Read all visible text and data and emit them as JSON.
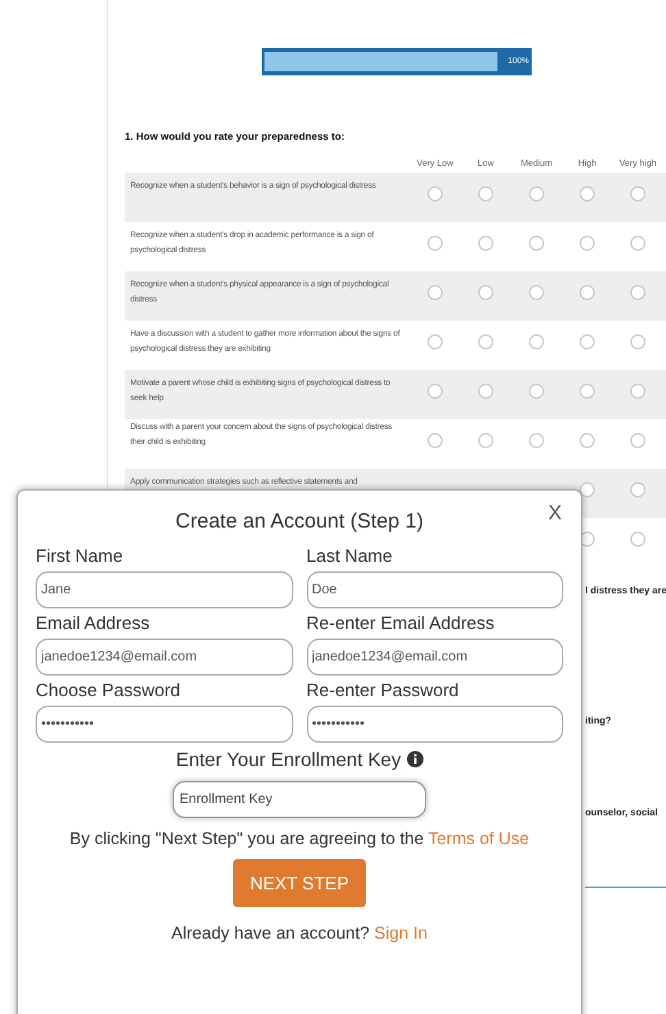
{
  "progress": {
    "label": "100%"
  },
  "question": {
    "title": "1. How would you rate your preparedness to:",
    "columns": [
      "Very Low",
      "Low",
      "Medium",
      "High",
      "Very high"
    ],
    "rows": [
      {
        "label": "Recognize when a student's behavior is a sign of psychological distress",
        "choices": [
          {
            "selected": false
          },
          {
            "selected": false
          },
          {
            "selected": false
          },
          {
            "selected": false
          },
          {
            "selected": false
          }
        ]
      },
      {
        "label": "Recognize when a student's drop in academic performance is a sign of psychological distress",
        "choices": [
          {
            "selected": false
          },
          {
            "selected": false
          },
          {
            "selected": false
          },
          {
            "selected": false
          },
          {
            "selected": false
          }
        ]
      },
      {
        "label": "Recognize when a student's physical appearance is a sign of psychological distress",
        "choices": [
          {
            "selected": false
          },
          {
            "selected": false
          },
          {
            "selected": false
          },
          {
            "selected": false
          },
          {
            "selected": false
          }
        ]
      },
      {
        "label": "Have a discussion with a student to gather more information about the signs of psychological distress they are exhibiting",
        "choices": [
          {
            "selected": false
          },
          {
            "selected": false
          },
          {
            "selected": false
          },
          {
            "selected": false
          },
          {
            "selected": false
          }
        ]
      },
      {
        "label": "Motivate a parent whose child is exhibiting signs of psychological distress to seek help",
        "choices": [
          {
            "selected": false
          },
          {
            "selected": false
          },
          {
            "selected": false
          },
          {
            "selected": false
          },
          {
            "selected": false
          }
        ]
      },
      {
        "label": "Discuss with a parent your concern about the signs of psychological distress their child is exhibiting",
        "choices": [
          {
            "selected": false
          },
          {
            "selected": false
          },
          {
            "selected": false
          },
          {
            "selected": false
          },
          {
            "selected": false
          }
        ]
      },
      {
        "label": "Apply communication strategies such as reflective statements and",
        "choices": [
          {
            "selected": false
          },
          {
            "selected": false
          }
        ]
      },
      {
        "choices": [
          {
            "selected": false
          },
          {
            "selected": false
          }
        ]
      }
    ]
  },
  "cut_questions": [
    "l distress they are",
    "iting?",
    "ounselor, social"
  ],
  "modal": {
    "title": "Create an Account (Step 1)",
    "close": "X",
    "fields": [
      {
        "label": "First Name",
        "value": "Jane"
      },
      {
        "label": "Last Name",
        "value": "Doe"
      },
      {
        "label": "Email Address",
        "value": "janedoe1234@email.com"
      },
      {
        "label": "Re-enter Email Address",
        "value": "janedoe1234@email.com"
      },
      {
        "label": "Choose Password",
        "value": "•••••••••••"
      },
      {
        "label": "Re-enter Password",
        "value": "•••••••••••"
      }
    ],
    "key_label": "Enter Your Enrollment Key",
    "key_field": {
      "placeholder": "Enrollment Key"
    },
    "terms_text": "By clicking \"Next Step\" you are agreeing to the",
    "terms_link": "Terms of Use",
    "button": "NEXT STEP",
    "signin_text": "Already have an account?",
    "signin_link": "Sign In"
  }
}
